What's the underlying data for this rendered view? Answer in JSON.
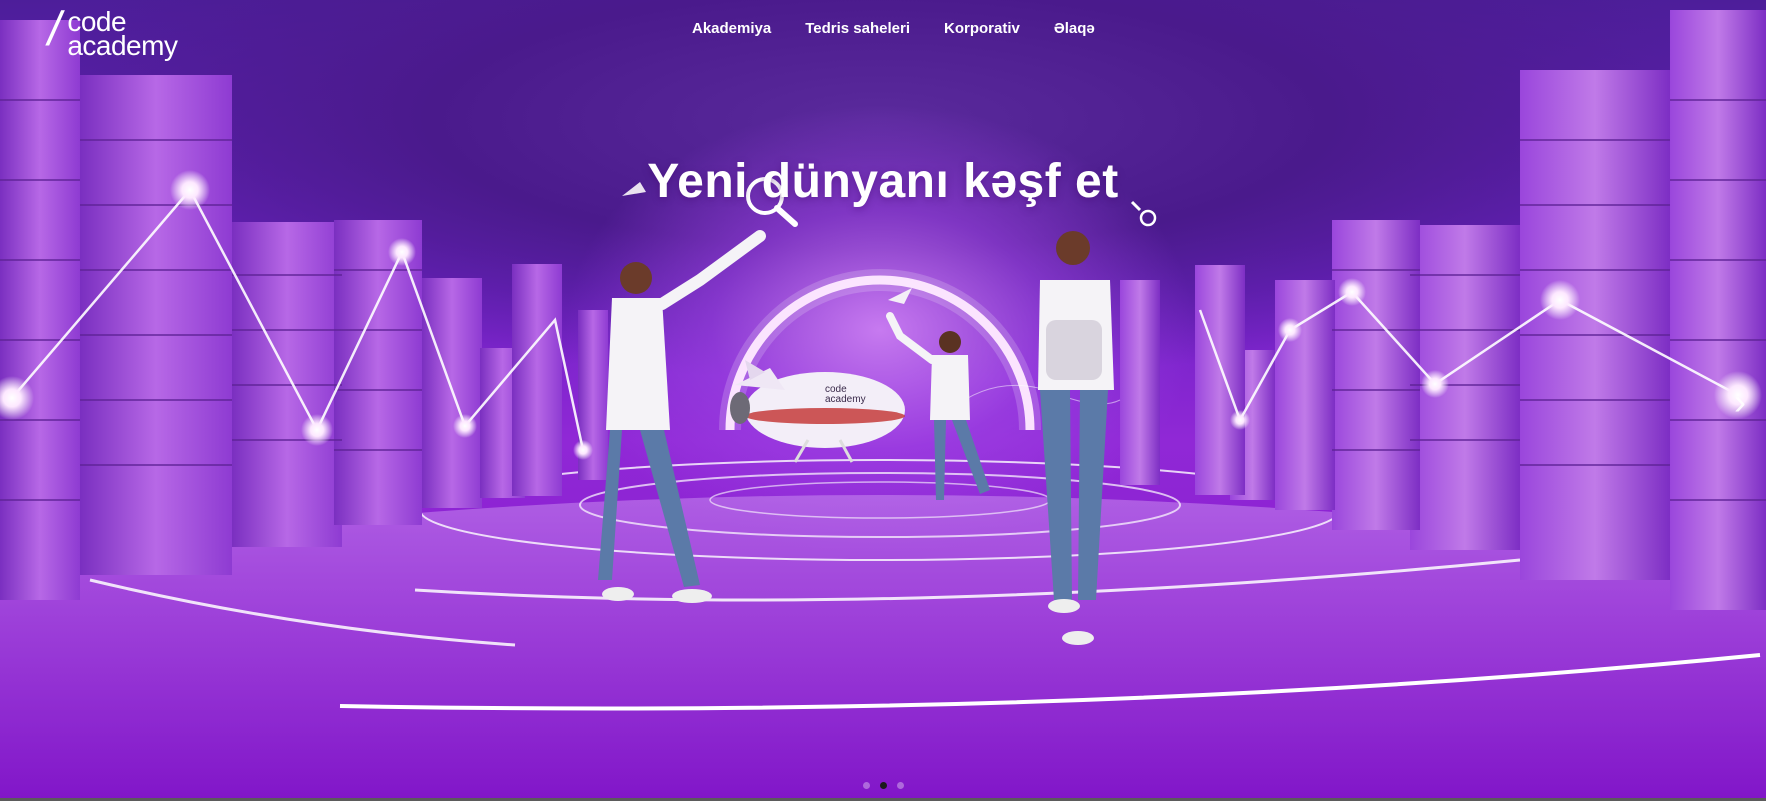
{
  "brand": {
    "line1": "code",
    "line2": "academy"
  },
  "nav": [
    {
      "label": "Akademiya"
    },
    {
      "label": "Tedris saheleri"
    },
    {
      "label": "Korporativ"
    },
    {
      "label": "Əlaqə"
    }
  ],
  "hero": {
    "headline": "Yeni dünyanı kəşf et",
    "rocket_label_1": "code",
    "rocket_label_2": "academy"
  },
  "carousel": {
    "slides": 3,
    "active_index": 1,
    "next_icon": "chevron-right-icon"
  },
  "colors": {
    "primary": "#8a1fd0",
    "accent": "#ffffff",
    "dark": "#4d1e9a"
  }
}
